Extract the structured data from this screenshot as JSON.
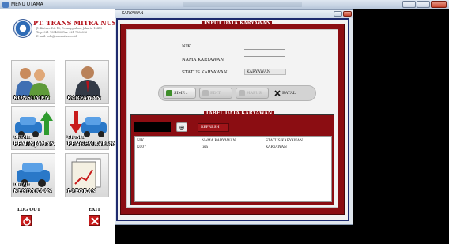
{
  "titlebar": {
    "title": "MENU UTAMA"
  },
  "sidebar": {
    "company": "PT. TRANS MITRA NUSANTARA",
    "address_lines": [
      "Jl. Bintaro Tol. 15, Pesanggrahan, Jakarta 15415",
      "Telp. 021-7354852 Fax. 021-7364896",
      "E-mail: info@transmitra.co.id"
    ],
    "tiles": [
      {
        "label": "KONSUMEN",
        "icon": "consumer-icon"
      },
      {
        "label": "KARYAWAN",
        "icon": "employee-icon"
      },
      {
        "small": "DETAIL",
        "label": "PEMINJAMAN",
        "icon": "car-up-icon"
      },
      {
        "small": "DETAIL",
        "label": "PENGEMBALIAN",
        "icon": "car-down-icon"
      },
      {
        "small": "DETAIL",
        "label": "KENDARAAN",
        "icon": "car-icon"
      },
      {
        "label": "LAPORAN",
        "icon": "report-icon"
      }
    ],
    "logout_label": "LOG OUT",
    "exit_label": "EXIT"
  },
  "window": {
    "title": "KARYAWAN",
    "legend_form": "INPUT DATA KARYAWAN",
    "fields": {
      "nik_label": "NIK",
      "nama_label": "NAMA KARYAWAN",
      "status_label": "STATUS KARYAWAN",
      "status_value": "KARYAWAN"
    },
    "buttons": {
      "simpan": "SIMP...",
      "edit": "EDIT",
      "hapus": "HAPUS",
      "batal": "BATAL"
    },
    "legend_table": "TABEL DATA KARYAWAN",
    "refresh_label": "REFRESH",
    "columns": [
      "NIK",
      "NAMA KARYAWAN",
      "STATUS KARYAWAN"
    ],
    "rows": [
      [
        "K007",
        "lisa",
        "KARYAWAN"
      ]
    ]
  },
  "colors": {
    "panel": "#8b0d12",
    "frame": "#1e2a6e"
  }
}
